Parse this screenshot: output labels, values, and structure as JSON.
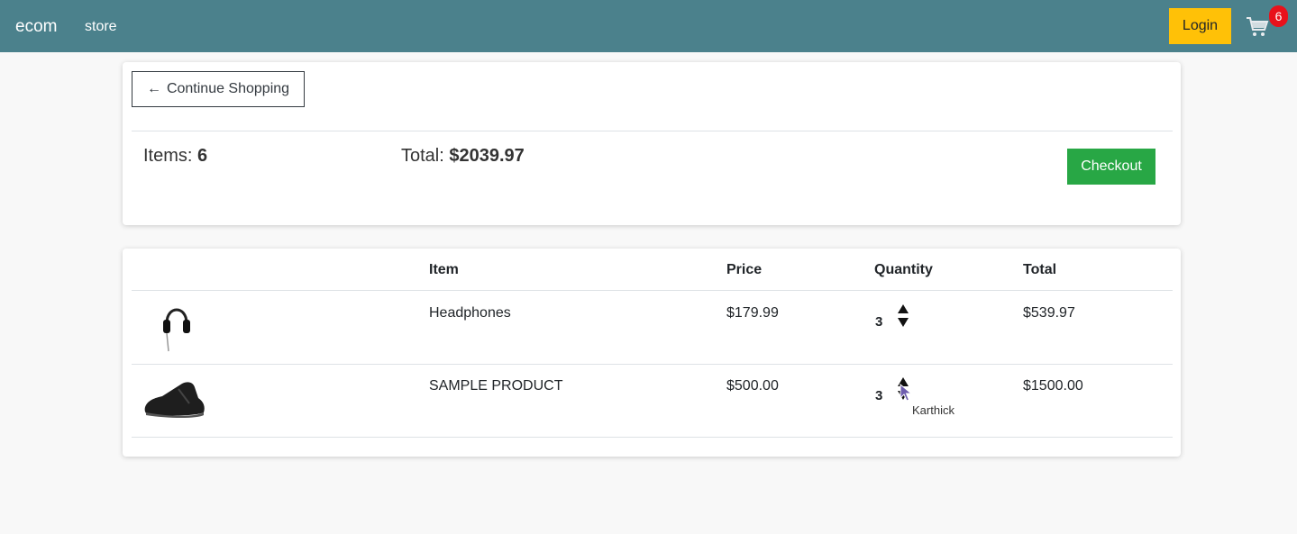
{
  "nav": {
    "brand": "ecom",
    "links": [
      "store"
    ],
    "login_label": "Login",
    "cart_icon": "cart-icon",
    "cart_count": "6"
  },
  "summary": {
    "continue_label": "Continue Shopping",
    "items_label": "Items:",
    "items_value": "6",
    "total_label": "Total:",
    "total_value": "$2039.97",
    "checkout_label": "Checkout"
  },
  "cart_table": {
    "headers": [
      "",
      "Item",
      "Price",
      "Quantity",
      "Total"
    ],
    "rows": [
      {
        "image": "headphones-image",
        "name": "Headphones",
        "price": "$179.99",
        "quantity": "3",
        "total": "$539.97"
      },
      {
        "image": "shoe-image",
        "name": "SAMPLE PRODUCT",
        "price": "$500.00",
        "quantity": "3",
        "total": "$1500.00"
      }
    ]
  },
  "cursor_tooltip": "Karthick",
  "colors": {
    "navbar": "#4b818c",
    "login": "#ffc107",
    "checkout": "#28a745",
    "badge": "#e8111b",
    "page_bg": "#f8f8f8"
  }
}
